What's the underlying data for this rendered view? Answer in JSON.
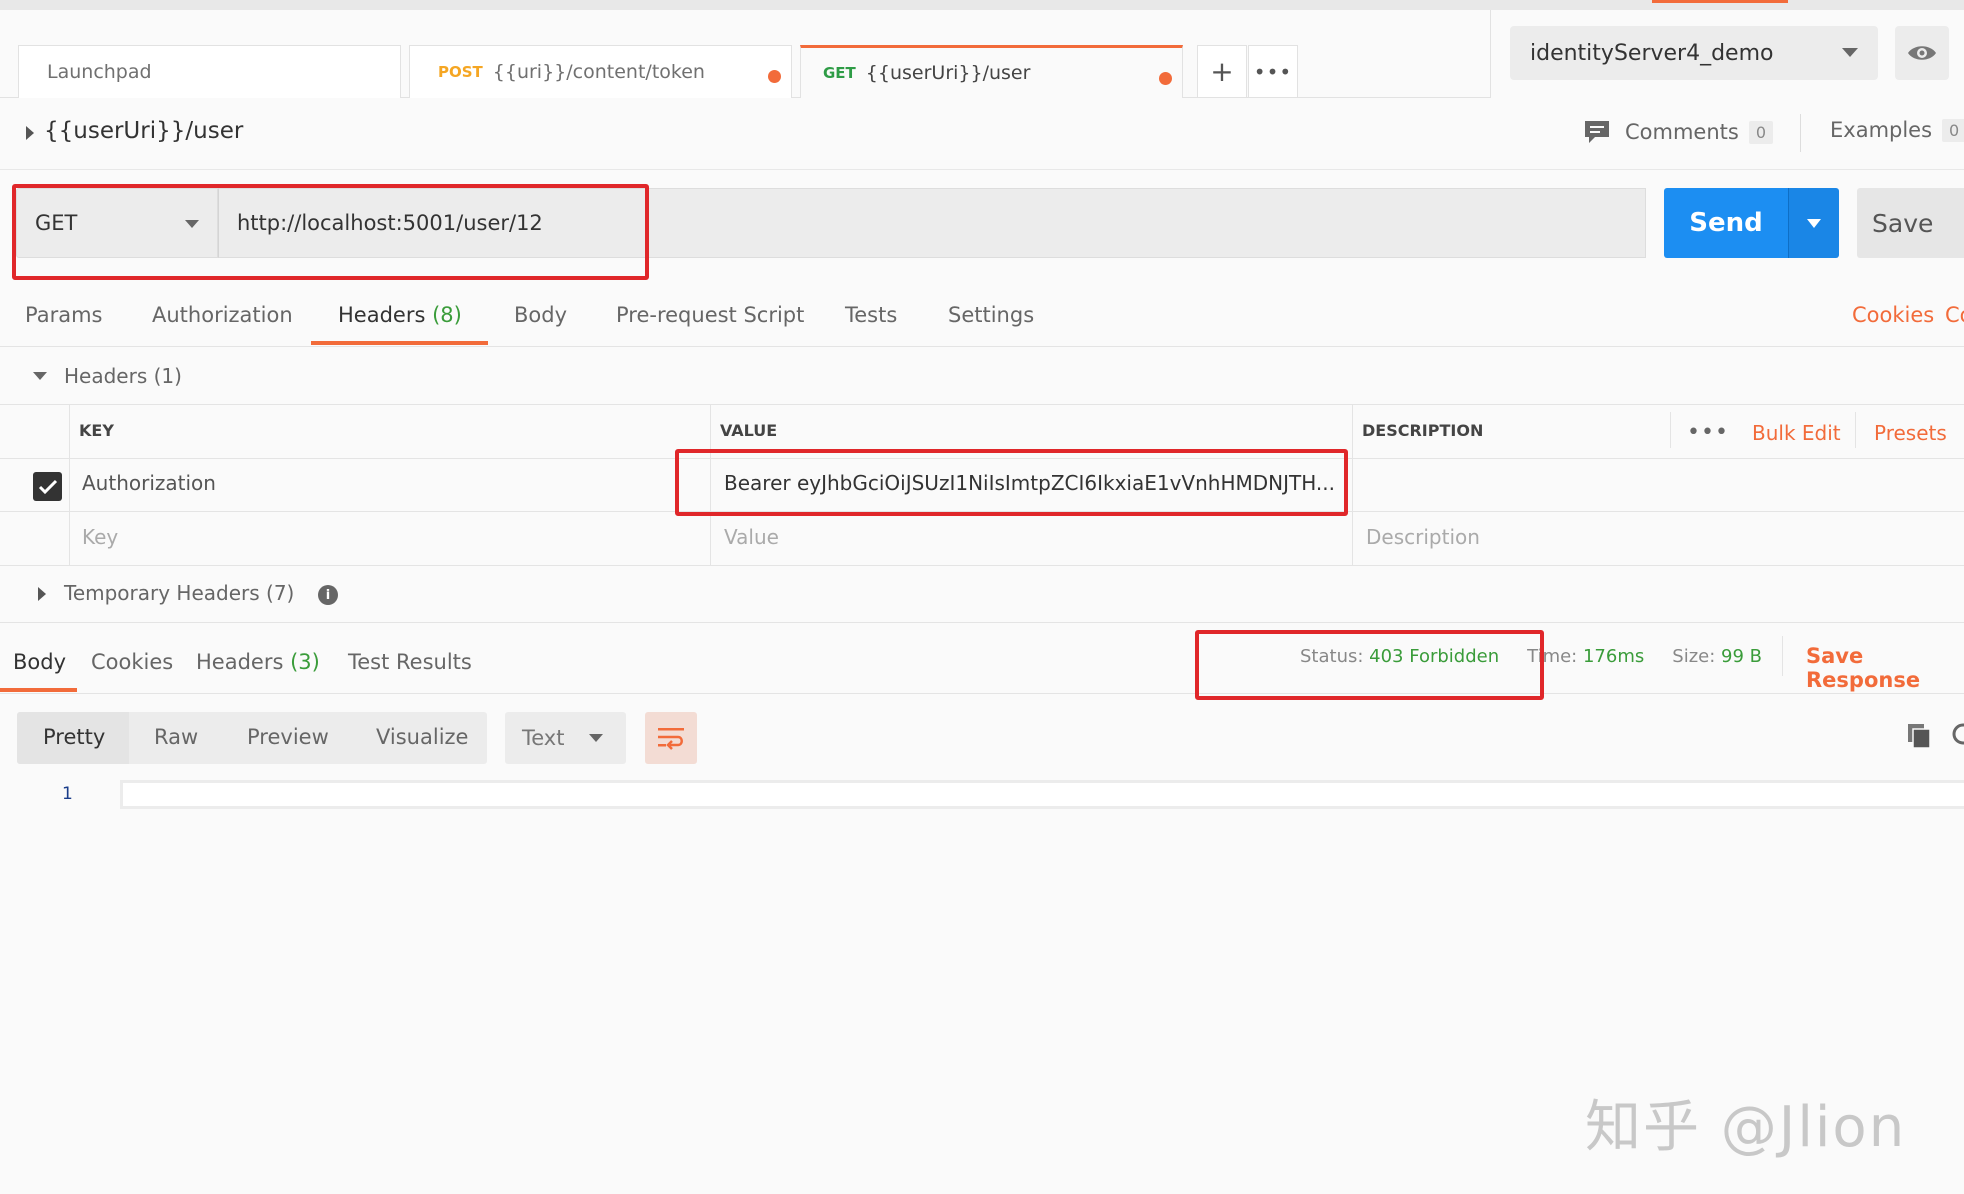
{
  "tabs": [
    {
      "label": "Launchpad"
    },
    {
      "method": "POST",
      "label": "{{uri}}/content/token",
      "method_color": "#f5a623"
    },
    {
      "method": "GET",
      "label": "{{userUri}}/user",
      "method_color": "#2e9c46"
    }
  ],
  "tab_actions": {
    "add": "+",
    "more": "•••"
  },
  "environment": {
    "selected": "identityServer4_demo"
  },
  "request": {
    "name": "{{userUri}}/user",
    "method": "GET",
    "url": "http://localhost:5001/user/12",
    "comments_label": "Comments",
    "comments_count": "0",
    "examples_label": "Examples",
    "examples_count": "0",
    "send_label": "Send",
    "save_label": "Save"
  },
  "request_tabs": {
    "params": "Params",
    "authorization": "Authorization",
    "headers": "Headers",
    "headers_count": "(8)",
    "body": "Body",
    "prerequest": "Pre-request Script",
    "tests": "Tests",
    "settings": "Settings",
    "cookies": "Cookies",
    "code": "Co"
  },
  "headers_section": {
    "title": "Headers  (1)",
    "columns": {
      "key": "KEY",
      "value": "VALUE",
      "description": "DESCRIPTION"
    },
    "bulk_edit": "Bulk Edit",
    "presets": "Presets",
    "more": "•••",
    "rows": [
      {
        "key": "Authorization",
        "value": "Bearer  eyJhbGciOiJSUzI1NiIsImtpZCI6IkxiaE1vVnhHMDNJTH...",
        "description": ""
      }
    ],
    "placeholder": {
      "key": "Key",
      "value": "Value",
      "description": "Description"
    },
    "temporary": "Temporary Headers  (7)"
  },
  "response": {
    "tabs": {
      "body": "Body",
      "cookies": "Cookies",
      "headers": "Headers",
      "headers_count": "(3)",
      "tests": "Test Results"
    },
    "status_label": "Status:",
    "status_value": "403 Forbidden",
    "time_label": "Time:",
    "time_value": "176ms",
    "size_label": "Size:",
    "size_value": "99 B",
    "save_response": "Save Response",
    "view_modes": {
      "pretty": "Pretty",
      "raw": "Raw",
      "preview": "Preview",
      "visualize": "Visualize"
    },
    "format": "Text",
    "line_number": "1"
  },
  "watermark": "知乎 @Jlion",
  "colors": {
    "accent": "#f26b3a",
    "send": "#1c8ef2",
    "success": "#3a9c3a",
    "highlight_box": "#e0272a"
  }
}
